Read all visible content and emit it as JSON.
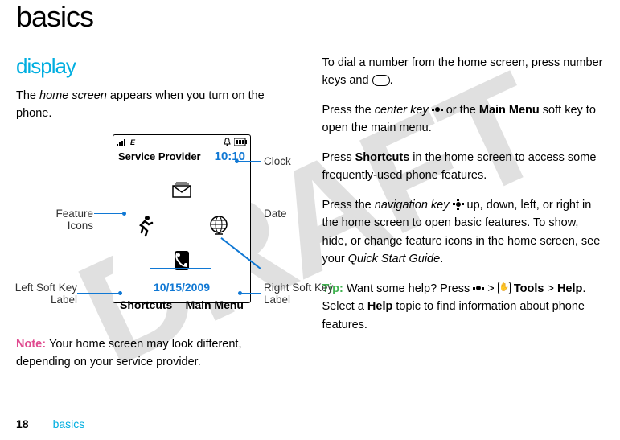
{
  "page": {
    "title": "basics",
    "section_label": "basics",
    "page_number": "18",
    "watermark": "DRAFT"
  },
  "left_col": {
    "subheading": "display",
    "para1_pre": "The ",
    "para1_em": "home screen",
    "para1_post": " appears when you turn on the phone.",
    "note_label": "Note: ",
    "note_text": "Your home screen may look different, depending on your service provider."
  },
  "right_col": {
    "p1_pre": "To dial a number from the home screen, press number keys and ",
    "p1_post": ".",
    "p2_a": "Press the ",
    "p2_em": "center key",
    "p2_b": " ",
    "p2_c": " or the ",
    "p2_mm": "Main Menu",
    "p2_d": " soft key to open the main menu.",
    "p3_a": "Press ",
    "p3_sc": "Shortcuts",
    "p3_b": " in the home screen to access some frequently-used phone features.",
    "p4_a": "Press the ",
    "p4_em": "navigation key",
    "p4_b": " ",
    "p4_c": " up, down, left, or right in the home screen to open basic features. To show, hide, or change feature icons in the home screen, see your ",
    "p4_em2": "Quick Start Guide",
    "p4_d": ".",
    "tip_label": "Tip: ",
    "tip_a": "Want some help? Press ",
    "tip_gt1": " > ",
    "tip_tools": " Tools",
    "tip_gt2": " > ",
    "tip_help": "Help",
    "tip_b": ". Select a ",
    "tip_help2": "Help",
    "tip_c": " topic to find information about phone features."
  },
  "diagram": {
    "service_provider": "Service Provider",
    "clock_value": "10:10",
    "date_value": "10/15/2009",
    "left_softkey": "Shortcuts",
    "right_softkey": "Main Menu",
    "callouts": {
      "clock": "Clock",
      "feature_icons": "Feature Icons",
      "date": "Date",
      "left_soft": "Left Soft Key Label",
      "right_soft": "Right Soft Key Label"
    },
    "icon_names": {
      "signal": "signal-icon",
      "edge": "edge-icon",
      "bell": "bell-icon",
      "battery": "battery-icon",
      "envelope": "envelope-icon",
      "running": "running-man-icon",
      "globe": "globe-icon",
      "contacts": "contacts-icon"
    }
  }
}
